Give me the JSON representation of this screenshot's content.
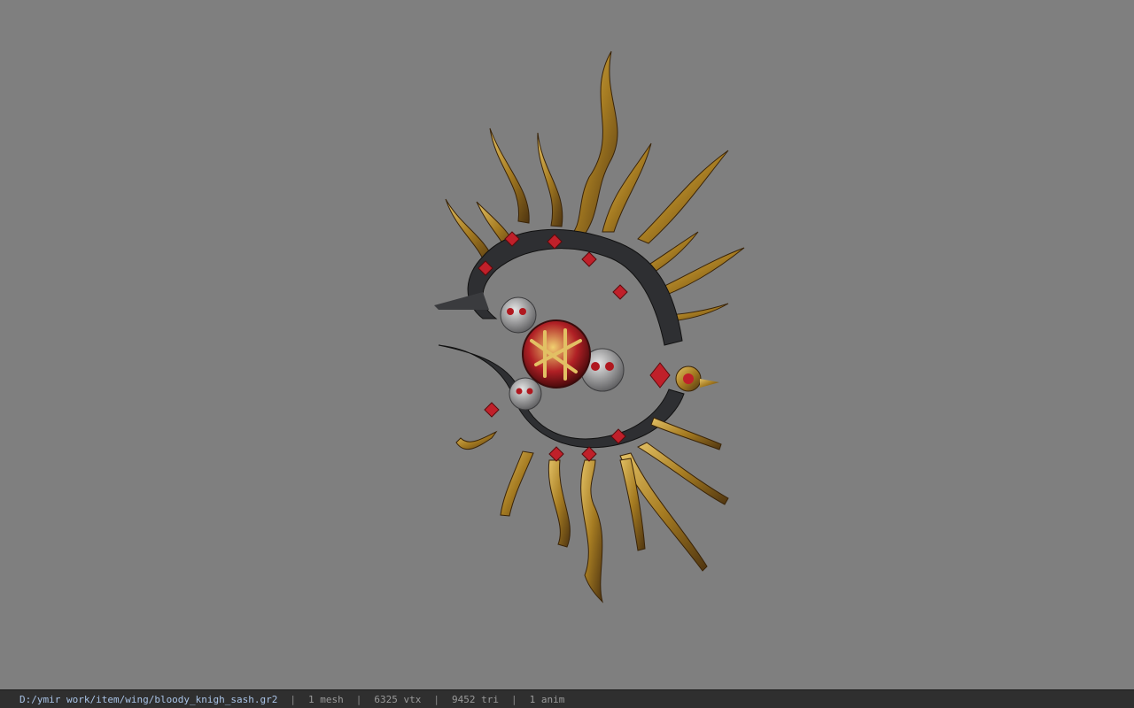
{
  "viewport": {
    "background_color": "#7f7f7f",
    "model_icon": "wing-sash-model"
  },
  "statusbar": {
    "file_path": "D:/ymir work/item/wing/bloody_knigh_sash.gr2",
    "separator": "|",
    "mesh": "1 mesh",
    "vertices": "6325 vtx",
    "triangles": "9452 tri",
    "animations": "1 anim"
  },
  "colors": {
    "gold": "#b8902c",
    "gold_dark": "#5a3d12",
    "dark_metal": "#2e2f32",
    "red_gem": "#c0202a",
    "silver": "#a9a9ab",
    "path_text": "#a9c3e6"
  }
}
